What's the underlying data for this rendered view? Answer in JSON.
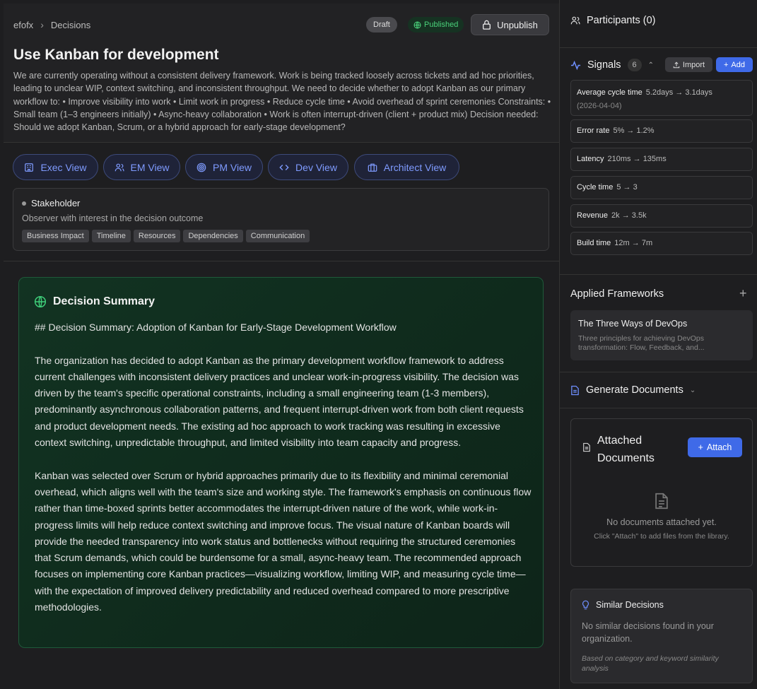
{
  "breadcrumb": {
    "root": "efofx",
    "current": "Decisions"
  },
  "status": {
    "draft": "Draft",
    "published": "Published",
    "unpublish": "Unpublish"
  },
  "decision": {
    "title": "Use Kanban for development",
    "description": "We are currently operating without a consistent delivery framework. Work is being tracked loosely across tickets and ad hoc priorities, leading to unclear WIP, context switching, and inconsistent throughput. We need to decide whether to adopt Kanban as our primary workflow to: • Improve visibility into work • Limit work in progress • Reduce cycle time • Avoid overhead of sprint ceremonies Constraints: • Small team (1–3 engineers initially) • Async-heavy collaboration • Work is often interrupt-driven (client + product mix) Decision needed: Should we adopt Kanban, Scrum, or a hybrid approach for early-stage development?"
  },
  "views": [
    "Exec View",
    "EM View",
    "PM View",
    "Dev View",
    "Architect View"
  ],
  "stakeholder": {
    "title": "Stakeholder",
    "subtitle": "Observer with interest in the decision outcome",
    "tags": [
      "Business Impact",
      "Timeline",
      "Resources",
      "Dependencies",
      "Communication"
    ]
  },
  "summary": {
    "title": "Decision Summary",
    "heading": "## Decision Summary: Adoption of Kanban for Early-Stage Development Workflow",
    "p1": "The organization has decided to adopt Kanban as the primary development workflow framework to address current challenges with inconsistent delivery practices and unclear work-in-progress visibility. The decision was driven by the team's specific operational constraints, including a small engineering team (1-3 members), predominantly asynchronous collaboration patterns, and frequent interrupt-driven work from both client requests and product development needs. The existing ad hoc approach to work tracking was resulting in excessive context switching, unpredictable throughput, and limited visibility into team capacity and progress.",
    "p2": "Kanban was selected over Scrum or hybrid approaches primarily due to its flexibility and minimal ceremonial overhead, which aligns well with the team's size and working style. The framework's emphasis on continuous flow rather than time-boxed sprints better accommodates the interrupt-driven nature of the work, while work-in-progress limits will help reduce context switching and improve focus. The visual nature of Kanban boards will provide the needed transparency into work status and bottlenecks without requiring the structured ceremonies that Scrum demands, which could be burdensome for a small, async-heavy team. The recommended approach focuses on implementing core Kanban practices—visualizing workflow, limiting WIP, and measuring cycle time—with the expectation of improved delivery predictability and reduced overhead compared to more prescriptive methodologies."
  },
  "sidebar": {
    "participants": "Participants (0)",
    "signals": {
      "title": "Signals",
      "count": "6",
      "import": "Import",
      "add": "Add",
      "items": [
        {
          "name": "Average cycle time",
          "from": "5.2days",
          "to": "3.1days",
          "date": "(2026-04-04)"
        },
        {
          "name": "Error rate",
          "from": "5%",
          "to": "1.2%"
        },
        {
          "name": "Latency",
          "from": "210ms",
          "to": "135ms"
        },
        {
          "name": "Cycle time",
          "from": "5",
          "to": "3"
        },
        {
          "name": "Revenue",
          "from": "2k",
          "to": "3.5k"
        },
        {
          "name": "Build time",
          "from": "12m",
          "to": "7m"
        }
      ]
    },
    "frameworks": {
      "title": "Applied Frameworks",
      "card_title": "The Three Ways of DevOps",
      "card_desc": "Three principles for achieving DevOps transformation: Flow, Feedback, and..."
    },
    "generate": "Generate Documents",
    "attached": {
      "title_line1": "Attached",
      "title_line2": "Documents",
      "attach": "Attach",
      "empty": "No documents attached yet.",
      "hint": "Click \"Attach\" to add files from the library."
    },
    "similar": {
      "title": "Similar Decisions",
      "empty": "No similar decisions found in your organization.",
      "note": "Based on category and keyword similarity analysis"
    }
  }
}
